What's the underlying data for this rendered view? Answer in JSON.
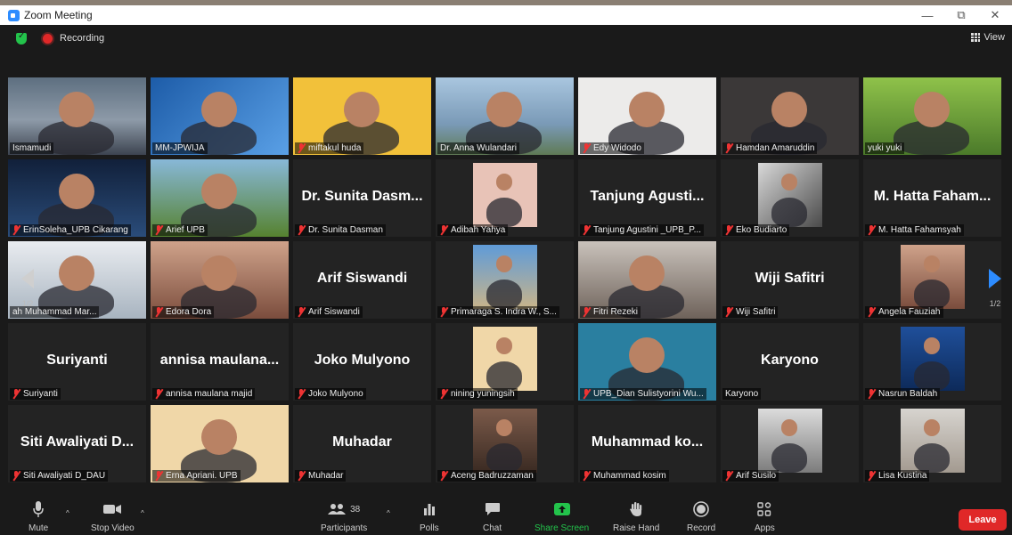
{
  "window": {
    "title": "Zoom Meeting",
    "minimize": "—",
    "maximize": "⧉",
    "close": "✕"
  },
  "meeting": {
    "recording_label": "Recording",
    "view_label": "View"
  },
  "pager": {
    "left_page": "1/2",
    "right_page": "1/2"
  },
  "participants": [
    {
      "display": "",
      "label": "Ismamudi",
      "muted": false,
      "video": "bg-office"
    },
    {
      "display": "",
      "label": "MM-JPWIJA",
      "muted": false,
      "video": "bg-blue"
    },
    {
      "display": "",
      "label": "miftakul huda",
      "muted": true,
      "video": "bg-yellow"
    },
    {
      "display": "",
      "label": "Dr. Anna Wulandari",
      "muted": false,
      "video": "bg-sky"
    },
    {
      "display": "",
      "label": "Edy Widodo",
      "muted": true,
      "video": "bg-white"
    },
    {
      "display": "",
      "label": "Hamdan Amaruddin",
      "muted": true,
      "video": "bg-dark"
    },
    {
      "display": "",
      "label": "yuki yuki",
      "muted": false,
      "video": "bg-green"
    },
    {
      "display": "",
      "label": "ErinSoleha_UPB Cikarang",
      "muted": true,
      "video": "bg-night"
    },
    {
      "display": "",
      "label": "Arief UPB",
      "muted": true,
      "video": "bg-tree"
    },
    {
      "display": "Dr. Sunita Dasm...",
      "label": "Dr. Sunita Dasman",
      "muted": true,
      "video": ""
    },
    {
      "display": "",
      "label": "Adibah Yahya",
      "muted": true,
      "video": "bg-pink"
    },
    {
      "display": "Tanjung Agusti...",
      "label": "Tanjung Agustini _UPB_P...",
      "muted": true,
      "video": ""
    },
    {
      "display": "",
      "label": "Eko Budiarto",
      "muted": true,
      "video": "bg-bw"
    },
    {
      "display": "M. Hatta Faham...",
      "label": "M. Hatta Fahamsyah",
      "muted": true,
      "video": ""
    },
    {
      "display": "",
      "label": "ah Muhammad Mar...",
      "muted": false,
      "video": "bg-campus"
    },
    {
      "display": "",
      "label": "Edora Dora",
      "muted": true,
      "video": "bg-skin"
    },
    {
      "display": "Arif Siswandi",
      "label": "Arif Siswandi",
      "muted": true,
      "video": ""
    },
    {
      "display": "",
      "label": "Primaraga S. Indra W., S...",
      "muted": true,
      "video": "bg-beach"
    },
    {
      "display": "",
      "label": "Fitri Rezeki",
      "muted": true,
      "video": "bg-room"
    },
    {
      "display": "Wiji Safitri",
      "label": "Wiji Safitri",
      "muted": true,
      "video": ""
    },
    {
      "display": "",
      "label": "Angela Fauziah",
      "muted": true,
      "video": "bg-skin"
    },
    {
      "display": "Suriyanti",
      "label": "Suriyanti",
      "muted": true,
      "video": ""
    },
    {
      "display": "annisa maulana...",
      "label": "annisa maulana majid",
      "muted": true,
      "video": ""
    },
    {
      "display": "Joko Mulyono",
      "label": "Joko Mulyono",
      "muted": true,
      "video": ""
    },
    {
      "display": "",
      "label": "nining yuningsih",
      "muted": true,
      "video": "bg-cream"
    },
    {
      "display": "",
      "label": "UPB_Dian Sulistyorini Wu...",
      "muted": true,
      "video": "bg-teal"
    },
    {
      "display": "Karyono",
      "label": "Karyono",
      "muted": false,
      "video": ""
    },
    {
      "display": "",
      "label": "Nasrun Baldah",
      "muted": true,
      "video": "bg-navy"
    },
    {
      "display": "Siti Awaliyati D...",
      "label": "Siti Awaliyati D_DAU",
      "muted": true,
      "video": ""
    },
    {
      "display": "",
      "label": "Erna Apriani. UPB",
      "muted": true,
      "video": "bg-cream"
    },
    {
      "display": "Muhadar",
      "label": "Muhadar",
      "muted": true,
      "video": ""
    },
    {
      "display": "",
      "label": "Aceng Badruzzaman",
      "muted": true,
      "video": "bg-brown"
    },
    {
      "display": "Muhammad ko...",
      "label": "Muhammad kosim",
      "muted": true,
      "video": ""
    },
    {
      "display": "",
      "label": "Arif Susilo",
      "muted": true,
      "video": "bg-grey"
    },
    {
      "display": "",
      "label": "Lisa Kustina",
      "muted": true,
      "video": "bg-hijab"
    }
  ],
  "toolbar": {
    "mute": "Mute",
    "stop_video": "Stop Video",
    "participants": "Participants",
    "participant_count": "38",
    "polls": "Polls",
    "chat": "Chat",
    "share_screen": "Share Screen",
    "raise_hand": "Raise Hand",
    "record": "Record",
    "apps": "Apps",
    "leave": "Leave"
  },
  "colors": {
    "accent_green": "#23c34b",
    "leave_red": "#e02828",
    "active_border": "#c8d63a",
    "zoom_blue": "#2d8cff"
  }
}
